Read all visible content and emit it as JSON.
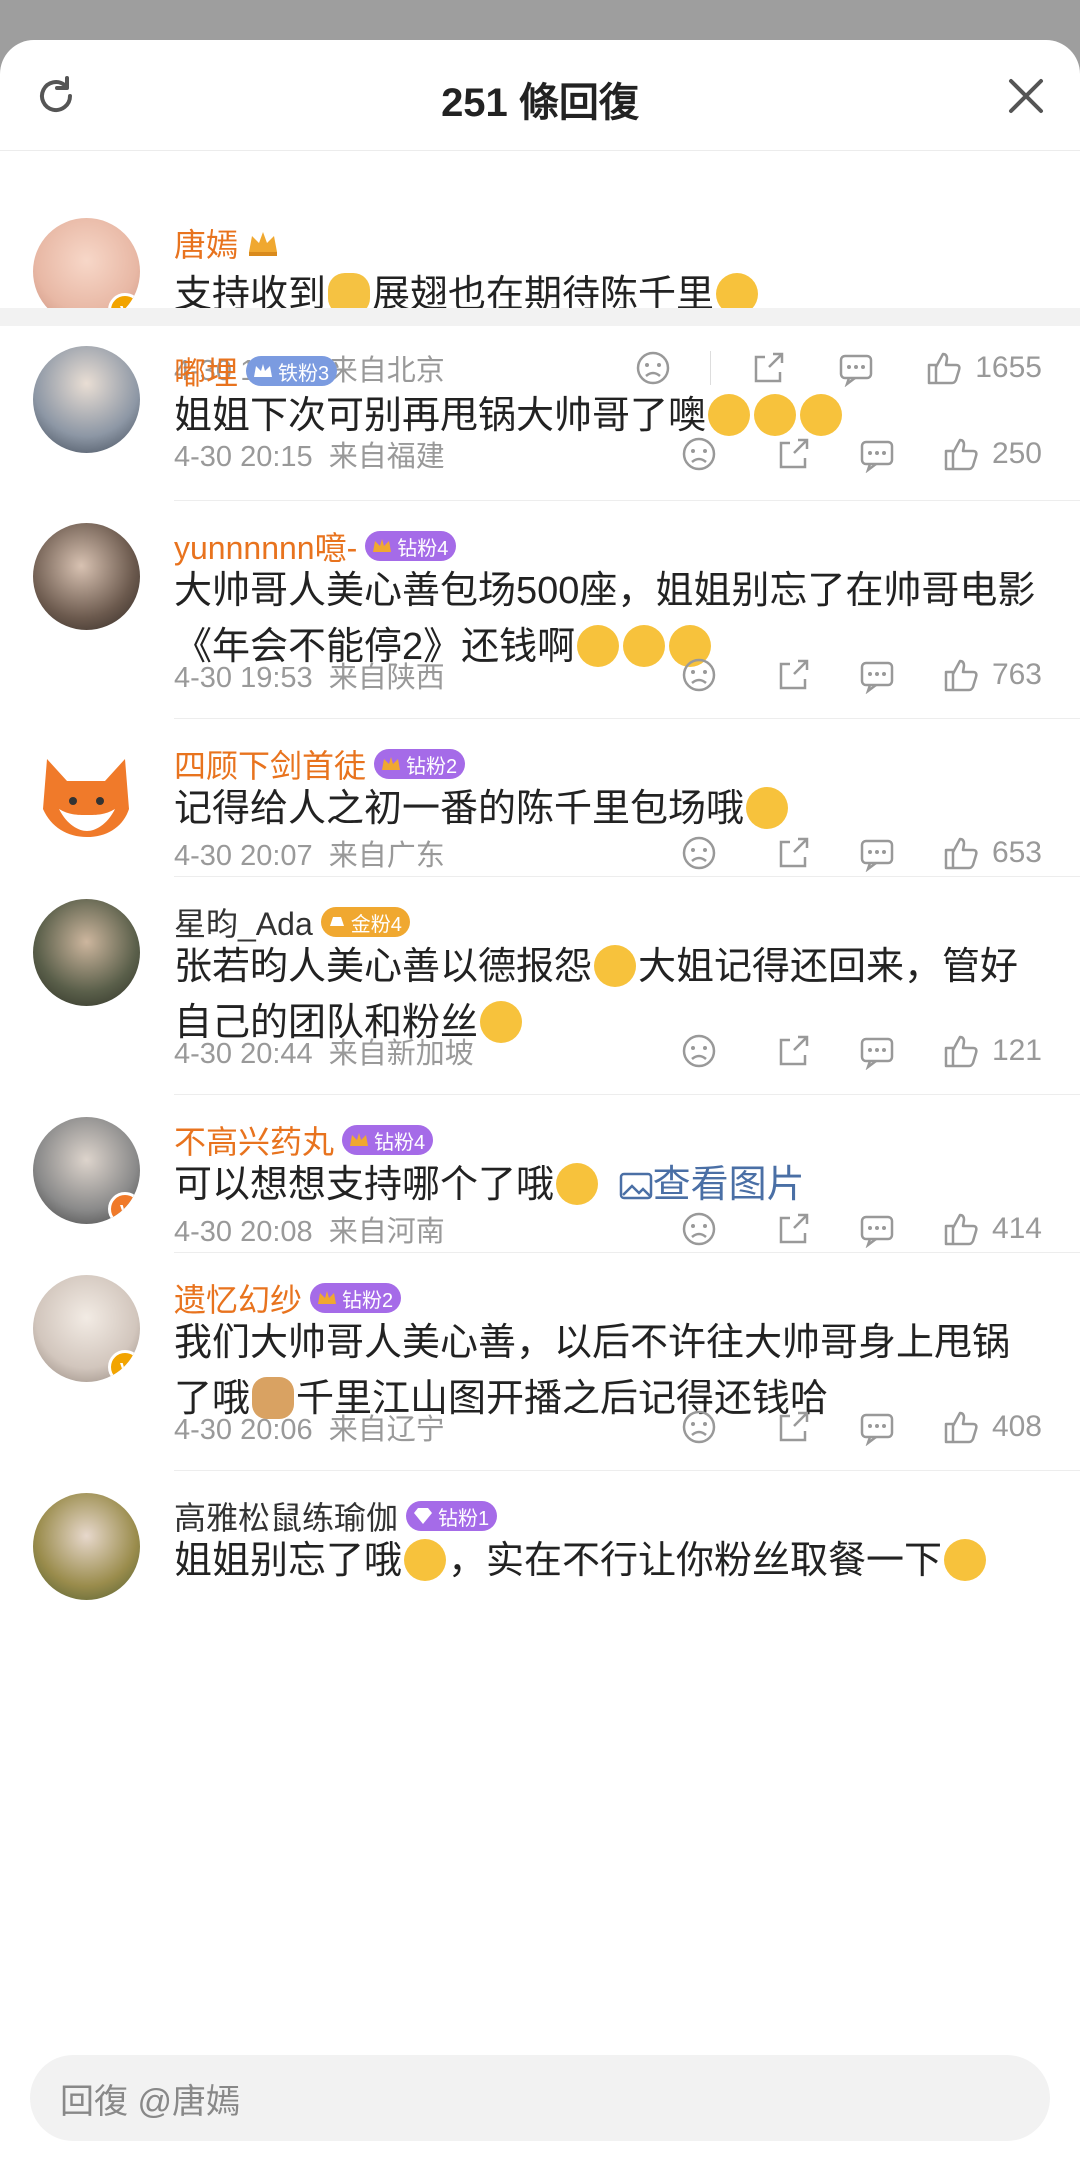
{
  "header": {
    "title": "251 條回復"
  },
  "main_comment": {
    "name": "唐嫣",
    "text_a": "支持收到",
    "text_b": "展翅也在期待陈千里",
    "time": "4-30 19:52",
    "location": "来自北京",
    "likes": "1655"
  },
  "replies": [
    {
      "name": "嘟埋",
      "badge": "铁粉3",
      "badge_color": "#7b9be0",
      "text": "姐姐下次可别再甩锅大帅哥了噢",
      "time": "4-30 20:15",
      "location": "来自福建",
      "likes": "250"
    },
    {
      "name": "yunnnnnn噫-",
      "badge": "钻粉4",
      "badge_color": "#a56be8",
      "text": "大帅哥人美心善包场500座，姐姐别忘了在帅哥电影《年会不能停2》还钱啊",
      "time": "4-30 19:53",
      "location": "来自陕西",
      "likes": "763"
    },
    {
      "name": "四顾下剑首徒",
      "badge": "钻粉2",
      "badge_color": "#a56be8",
      "text": "记得给人之初一番的陈千里包场哦",
      "time": "4-30 20:07",
      "location": "来自广东",
      "likes": "653"
    },
    {
      "name": "星昀_Ada",
      "badge": "金粉4",
      "badge_color": "#f0a830",
      "text": "张若昀人美心善以德报怨",
      "text2": "大姐记得还回来，管好自己的团队和粉丝",
      "time": "4-30 20:44",
      "location": "来自新加坡",
      "likes": "121"
    },
    {
      "name": "不高兴药丸",
      "badge": "钻粉4",
      "badge_color": "#a56be8",
      "text": "可以想想支持哪个了哦",
      "link": "查看图片",
      "time": "4-30 20:08",
      "location": "来自河南",
      "likes": "414"
    },
    {
      "name": "遗忆幻纱",
      "badge": "钻粉2",
      "badge_color": "#a56be8",
      "text": "我们大帅哥人美心善，以后不许往大帅哥身上甩锅了哦",
      "text2": "千里江山图开播之后记得还钱哈",
      "time": "4-30 20:06",
      "location": "来自辽宁",
      "likes": "408"
    },
    {
      "name": "高雅松鼠练瑜伽",
      "badge": "钻粉1",
      "badge_color": "#a56be8",
      "text": "姐姐别忘了哦",
      "text2": "，实在不行让你粉丝取餐一下"
    }
  ],
  "reply_bar": {
    "placeholder": "回復 @唐嫣"
  },
  "colors": {
    "accent_name": "#e8731e",
    "link": "#4a6fa5"
  }
}
